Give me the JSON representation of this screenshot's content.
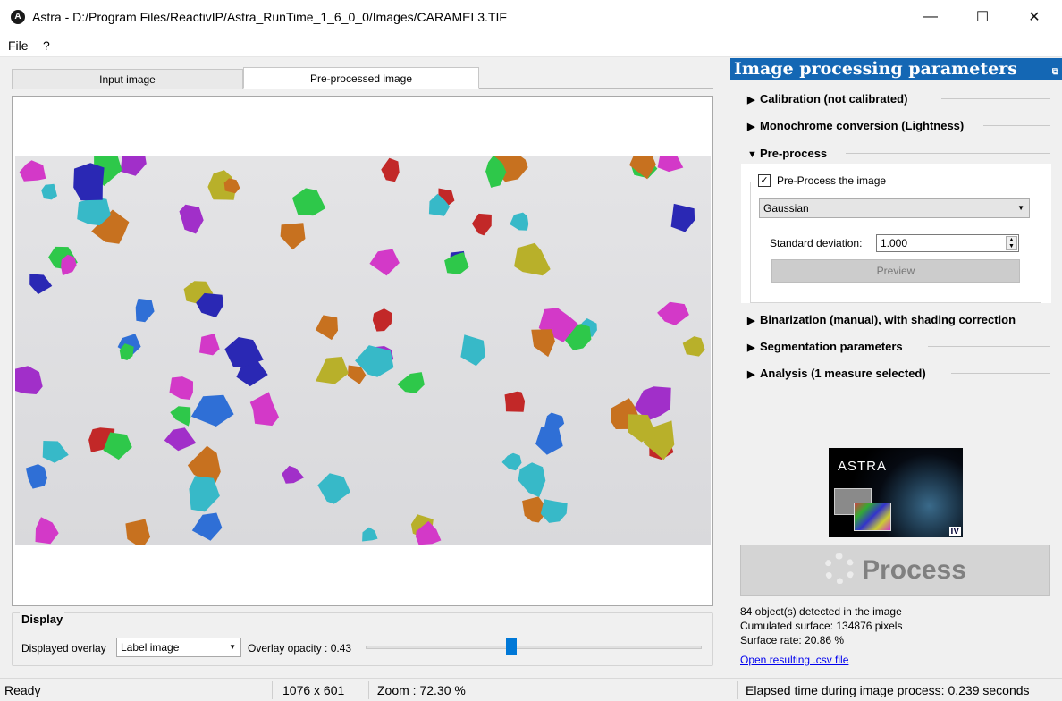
{
  "window": {
    "title": "Astra - D:/Program Files/ReactivIP/Astra_RunTime_1_6_0_0/Images/CARAMEL3.TIF",
    "icon_letter": "A",
    "minimize_glyph": "—",
    "maximize_glyph": "☐",
    "close_glyph": "✕"
  },
  "menu": {
    "items": [
      "File",
      "?"
    ]
  },
  "tabs": [
    {
      "label": "Input image",
      "active": false
    },
    {
      "label": "Pre-processed image",
      "active": true
    }
  ],
  "display": {
    "title": "Display",
    "overlay_label": "Displayed overlay",
    "overlay_value": "Label image",
    "opacity_label": "Overlay opacity : 0.43",
    "opacity_value": 0.43
  },
  "status": {
    "ready": "Ready",
    "size": "1076 x 601",
    "zoom": "Zoom : 72.30 %",
    "elapsed": "Elapsed time during image process: 0.239 seconds"
  },
  "panel": {
    "title": "Image processing parameters",
    "float_glyph": "⧉",
    "sections": [
      {
        "label": "Calibration (not calibrated)",
        "expanded": false
      },
      {
        "label": "Monochrome conversion (Lightness)",
        "expanded": false
      },
      {
        "label": "Pre-process",
        "expanded": true
      },
      {
        "label": "Binarization (manual), with shading correction",
        "expanded": false
      },
      {
        "label": "Segmentation parameters",
        "expanded": false
      },
      {
        "label": "Analysis (1 measure selected)",
        "expanded": false
      }
    ],
    "preprocess": {
      "checkbox_label": "Pre-Process the image",
      "checked": true,
      "filter": "Gaussian",
      "std_label": "Standard deviation:",
      "std_value": "1.000",
      "preview_label": "Preview"
    },
    "logo": {
      "text": "ASTRA",
      "badge": "IV"
    },
    "process_label": "Process",
    "results": [
      "84 object(s) detected in the image",
      "Cumulated surface: 134876 pixels",
      "Surface rate: 20.86 %"
    ],
    "csv_link": "Open resulting .csv file"
  },
  "colors": {
    "header_blue": "#1467b4",
    "accent_blue": "#0078d7",
    "link": "#0000ee",
    "blobs": [
      "#2f6fd6",
      "#37b9c8",
      "#2ec84a",
      "#b8b02a",
      "#c7711f",
      "#c22828",
      "#a12fc9",
      "#d339c8",
      "#2a28b4"
    ]
  }
}
